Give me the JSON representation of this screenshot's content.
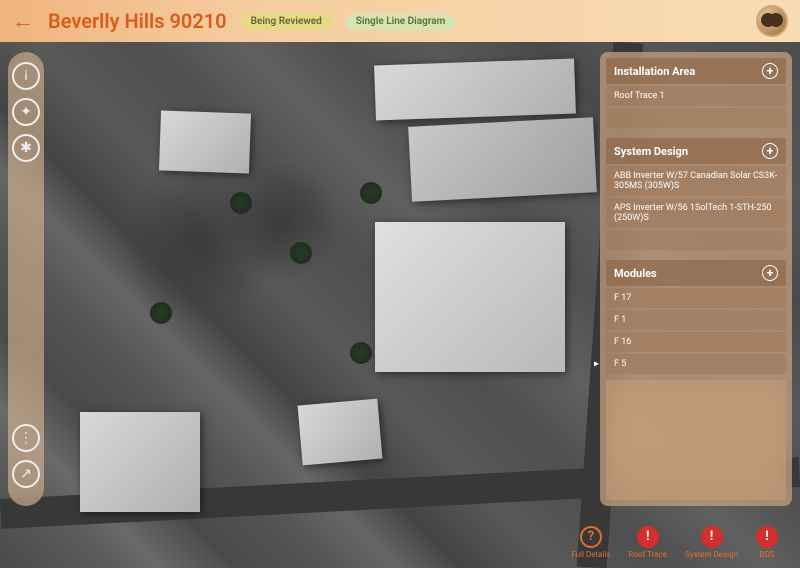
{
  "header": {
    "title": "Beverlly Hills 90210",
    "badges": {
      "review": "Being Reviewed",
      "diagram": "Single Line Diagram"
    }
  },
  "toolbar": {
    "top": [
      {
        "name": "info-icon",
        "glyph": "i"
      },
      {
        "name": "compass-icon",
        "glyph": "✦"
      },
      {
        "name": "user-icon",
        "glyph": "✱"
      }
    ],
    "bottom": [
      {
        "name": "more-icon",
        "glyph": "⋮"
      },
      {
        "name": "share-icon",
        "glyph": "↗"
      }
    ]
  },
  "panel": {
    "installation": {
      "title": "Installation Area",
      "items": [
        "Roof Trace 1"
      ]
    },
    "system": {
      "title": "System Design",
      "items": [
        "ABB Inverter W/57 Canadian Solar CS3K-305MS (305W)S",
        "APS Inverter W/56 1SolTech 1-STH-250 (250W)S"
      ]
    },
    "modules": {
      "title": "Modules",
      "items": [
        "F 17",
        "F 1",
        "F 16",
        "F 5"
      ]
    }
  },
  "footer": {
    "details": {
      "label": "Full Details",
      "glyph": "?"
    },
    "roof": {
      "label": "Roof Trace",
      "glyph": "!"
    },
    "system": {
      "label": "System Design",
      "glyph": "!"
    },
    "bos": {
      "label": "BOS",
      "glyph": "!"
    }
  }
}
